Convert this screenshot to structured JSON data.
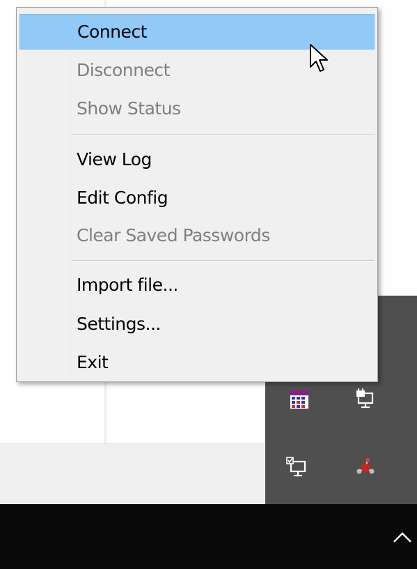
{
  "context_menu": {
    "items": [
      {
        "label": "Connect",
        "enabled": true,
        "highlighted": true
      },
      {
        "label": "Disconnect",
        "enabled": false
      },
      {
        "label": "Show Status",
        "enabled": false
      },
      {
        "label": "View Log",
        "enabled": true
      },
      {
        "label": "Edit Config",
        "enabled": true
      },
      {
        "label": "Clear Saved Passwords",
        "enabled": false
      },
      {
        "label": "Import file...",
        "enabled": true
      },
      {
        "label": "Settings...",
        "enabled": true
      },
      {
        "label": "Exit",
        "enabled": true
      }
    ]
  },
  "tray": {
    "icons": [
      {
        "name": "calendar-app-icon"
      },
      {
        "name": "network-lock-icon"
      },
      {
        "name": "network-monitor-icon"
      },
      {
        "name": "molecule-app-icon"
      }
    ],
    "chevron": "chevron-up-icon"
  },
  "colors": {
    "highlight": "#91c9f7",
    "menu_background": "#f0f0f0",
    "disabled_text": "#7f7f7f",
    "tray_background": "#4f4f4f",
    "taskbar": "#0a0a0a"
  }
}
